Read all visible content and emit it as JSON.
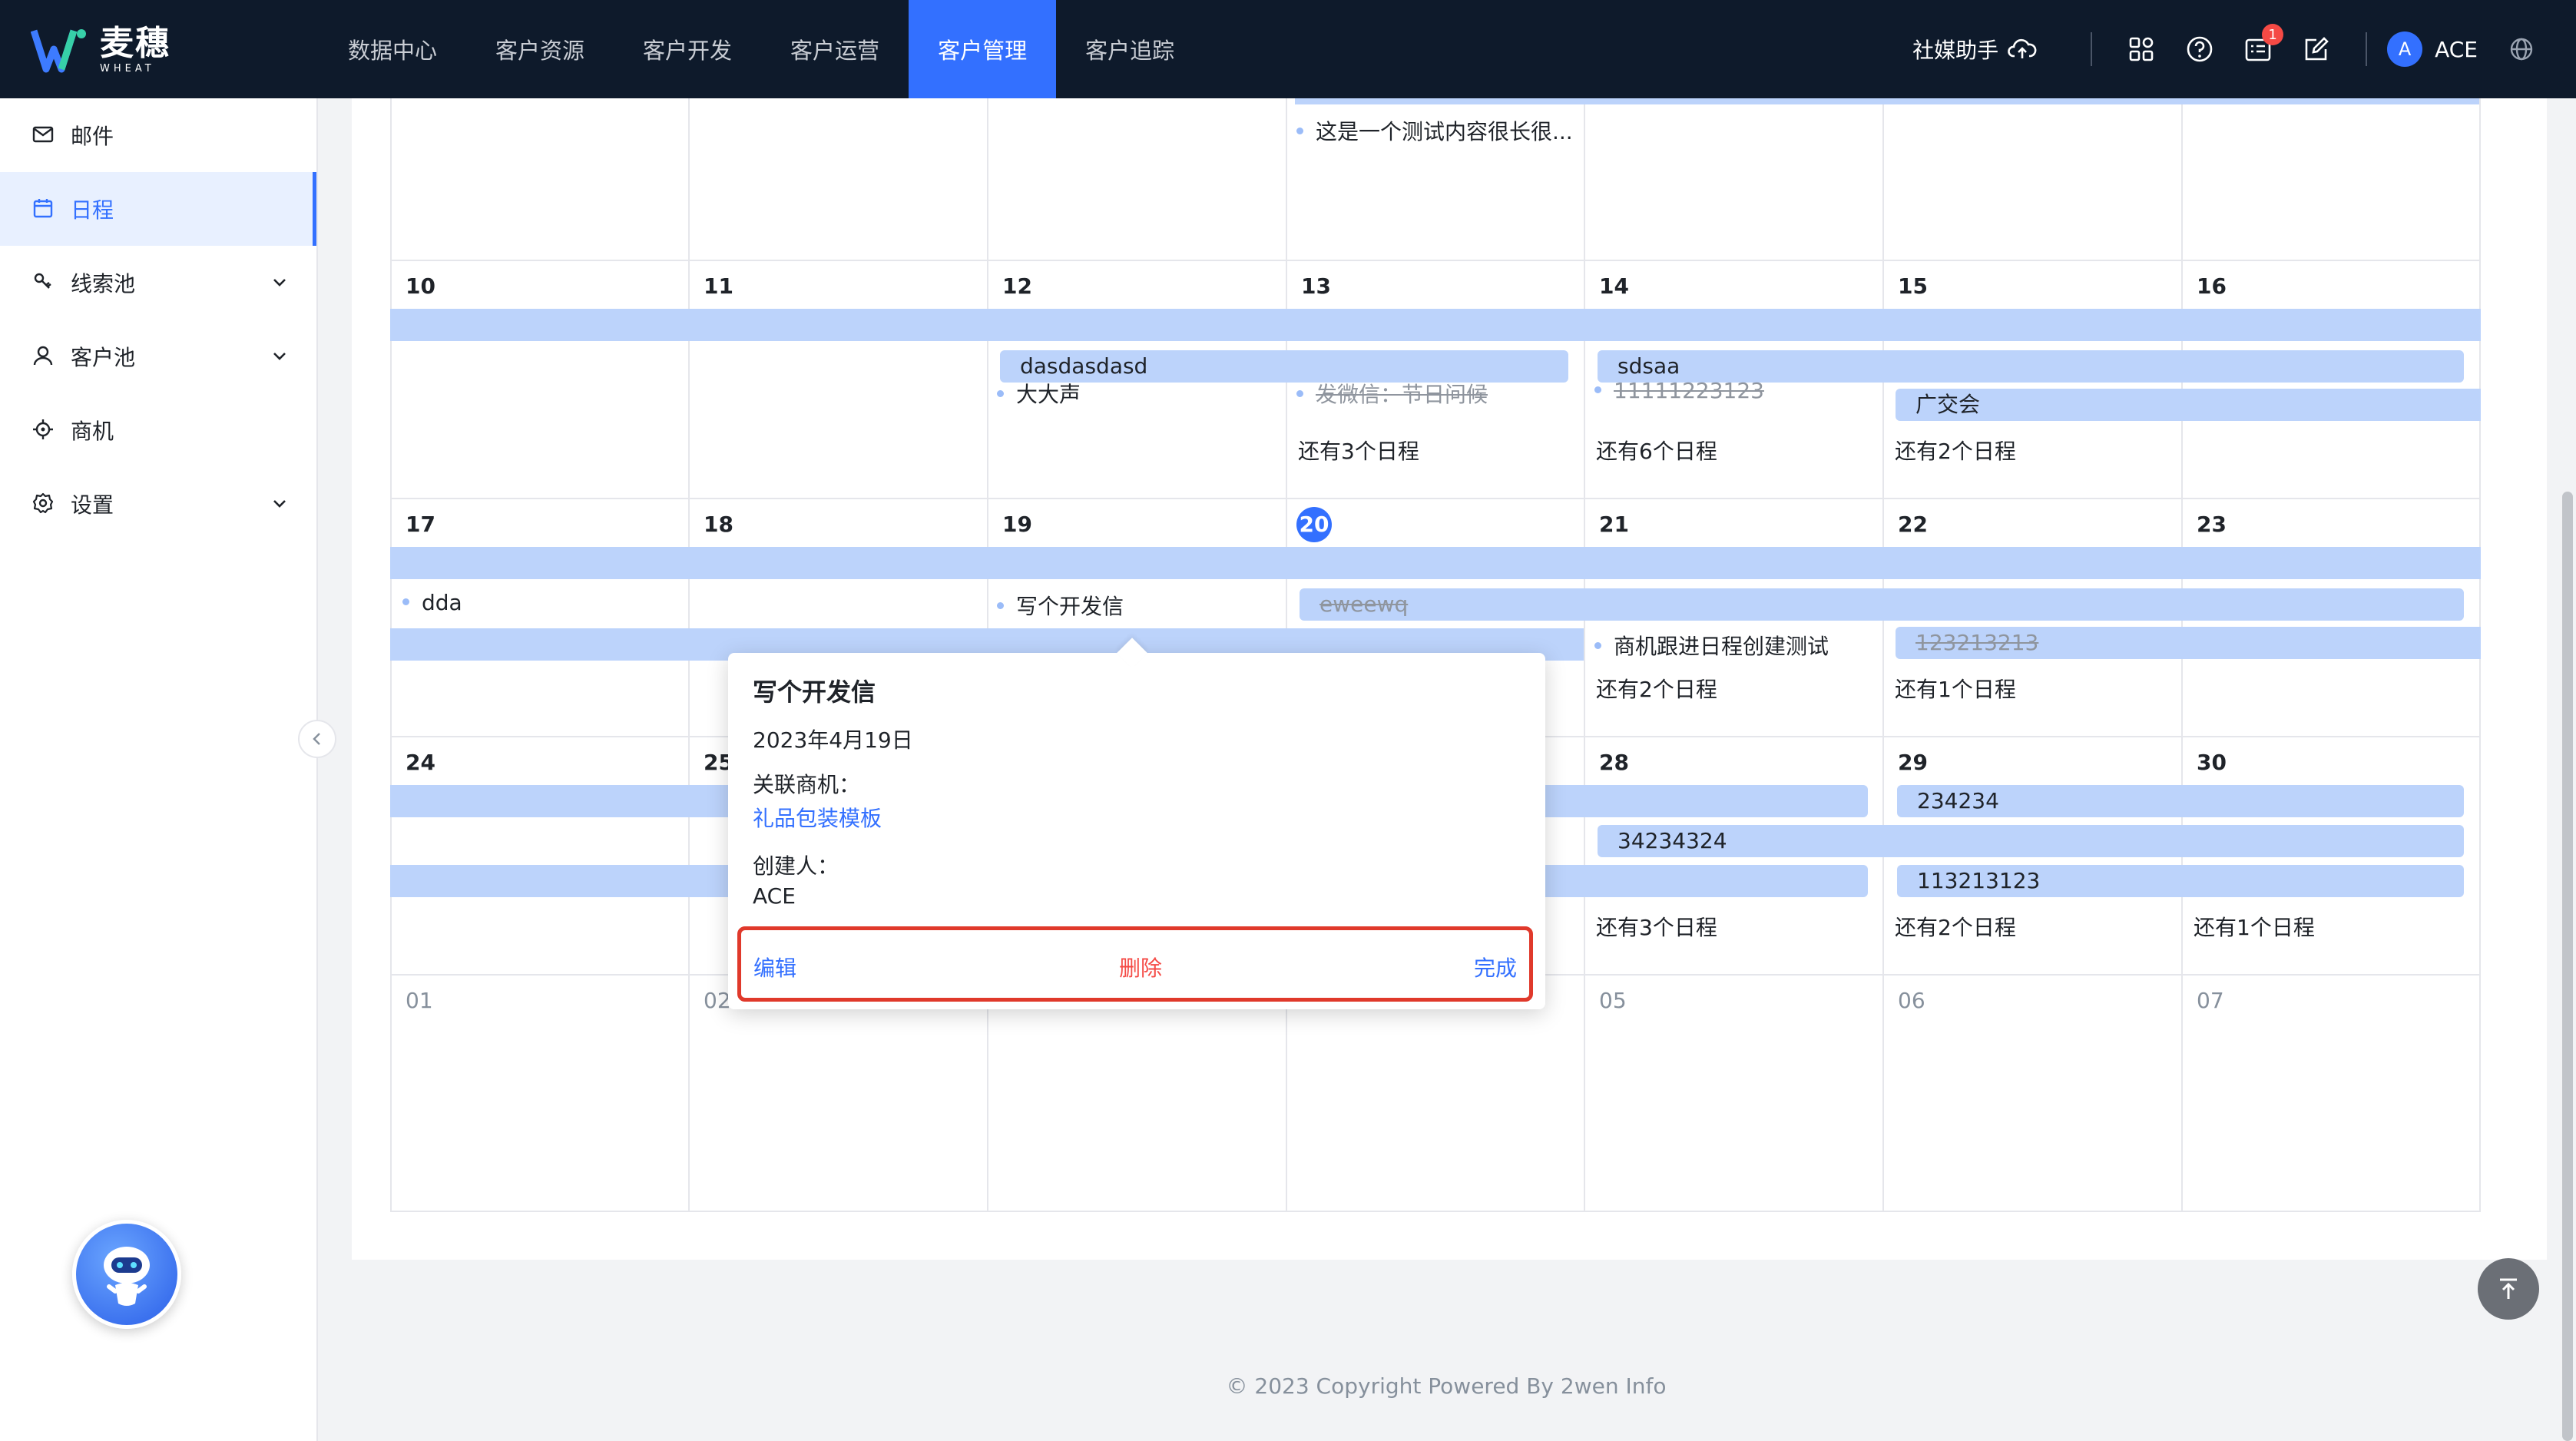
{
  "brand": {
    "name_cn": "麦穗",
    "name_en": "WHEAT"
  },
  "nav": {
    "items": [
      {
        "label": "数据中心",
        "active": false
      },
      {
        "label": "客户资源",
        "active": false
      },
      {
        "label": "客户开发",
        "active": false
      },
      {
        "label": "客户运营",
        "active": false
      },
      {
        "label": "客户管理",
        "active": true
      },
      {
        "label": "客户追踪",
        "active": false
      }
    ]
  },
  "topbar": {
    "social_label": "社媒助手",
    "notification_count": "1",
    "avatar_letter": "A",
    "user_name": "ACE"
  },
  "sidebar": {
    "items": [
      {
        "label": "邮件",
        "icon": "mail-icon"
      },
      {
        "label": "日程",
        "icon": "calendar-icon",
        "active": true
      },
      {
        "label": "线索池",
        "icon": "clue-icon",
        "expandable": true
      },
      {
        "label": "客户池",
        "icon": "user-icon",
        "expandable": true
      },
      {
        "label": "商机",
        "icon": "target-icon"
      },
      {
        "label": "设置",
        "icon": "gear-icon",
        "expandable": true
      }
    ]
  },
  "calendar": {
    "row0": {
      "event1": "这是一个测试内容很长很..."
    },
    "row1": {
      "days": [
        "10",
        "11",
        "12",
        "13",
        "14",
        "15",
        "16"
      ],
      "bar1": "dasdasdasd",
      "bar2": "sdsaa",
      "bar3": "广交会",
      "ev1": "大大声",
      "ev2": "发微信：节日问候",
      "ev3": "11111223123",
      "more1": "还有3个日程",
      "more2": "还有6个日程",
      "more3": "还有2个日程"
    },
    "row2": {
      "days": [
        "17",
        "18",
        "19",
        "20",
        "21",
        "22",
        "23"
      ],
      "ev1": "dda",
      "ev2": "写个开发信",
      "bar1": "eweewq",
      "ev3": "商机跟进日程创建测试",
      "bar2": "123213213",
      "more1": "还有2个日程",
      "more2": "还有1个日程"
    },
    "row3": {
      "days": [
        "24",
        "25",
        "28",
        "29",
        "30"
      ],
      "bar1": "234234",
      "bar2": "34234324",
      "bar3": "113213123",
      "more1": "还有3个日程",
      "more2": "还有2个日程",
      "more3": "还有1个日程"
    },
    "row4": {
      "days": [
        "01",
        "02",
        "05",
        "06",
        "07"
      ]
    }
  },
  "popover": {
    "title": "写个开发信",
    "date": "2023年4月19日",
    "related_label": "关联商机：",
    "related_value": "礼品包装模板",
    "creator_label": "创建人：",
    "creator_value": "ACE",
    "edit_label": "编辑",
    "delete_label": "删除",
    "done_label": "完成"
  },
  "footer": {
    "text": "© 2023 Copyright Powered By 2wen Info"
  },
  "colors": {
    "primary": "#3370ff",
    "danger": "#f54a45",
    "topbar": "#0e1a2b",
    "event_bar": "#bcd3fb",
    "highlight_border": "#e0392b"
  }
}
